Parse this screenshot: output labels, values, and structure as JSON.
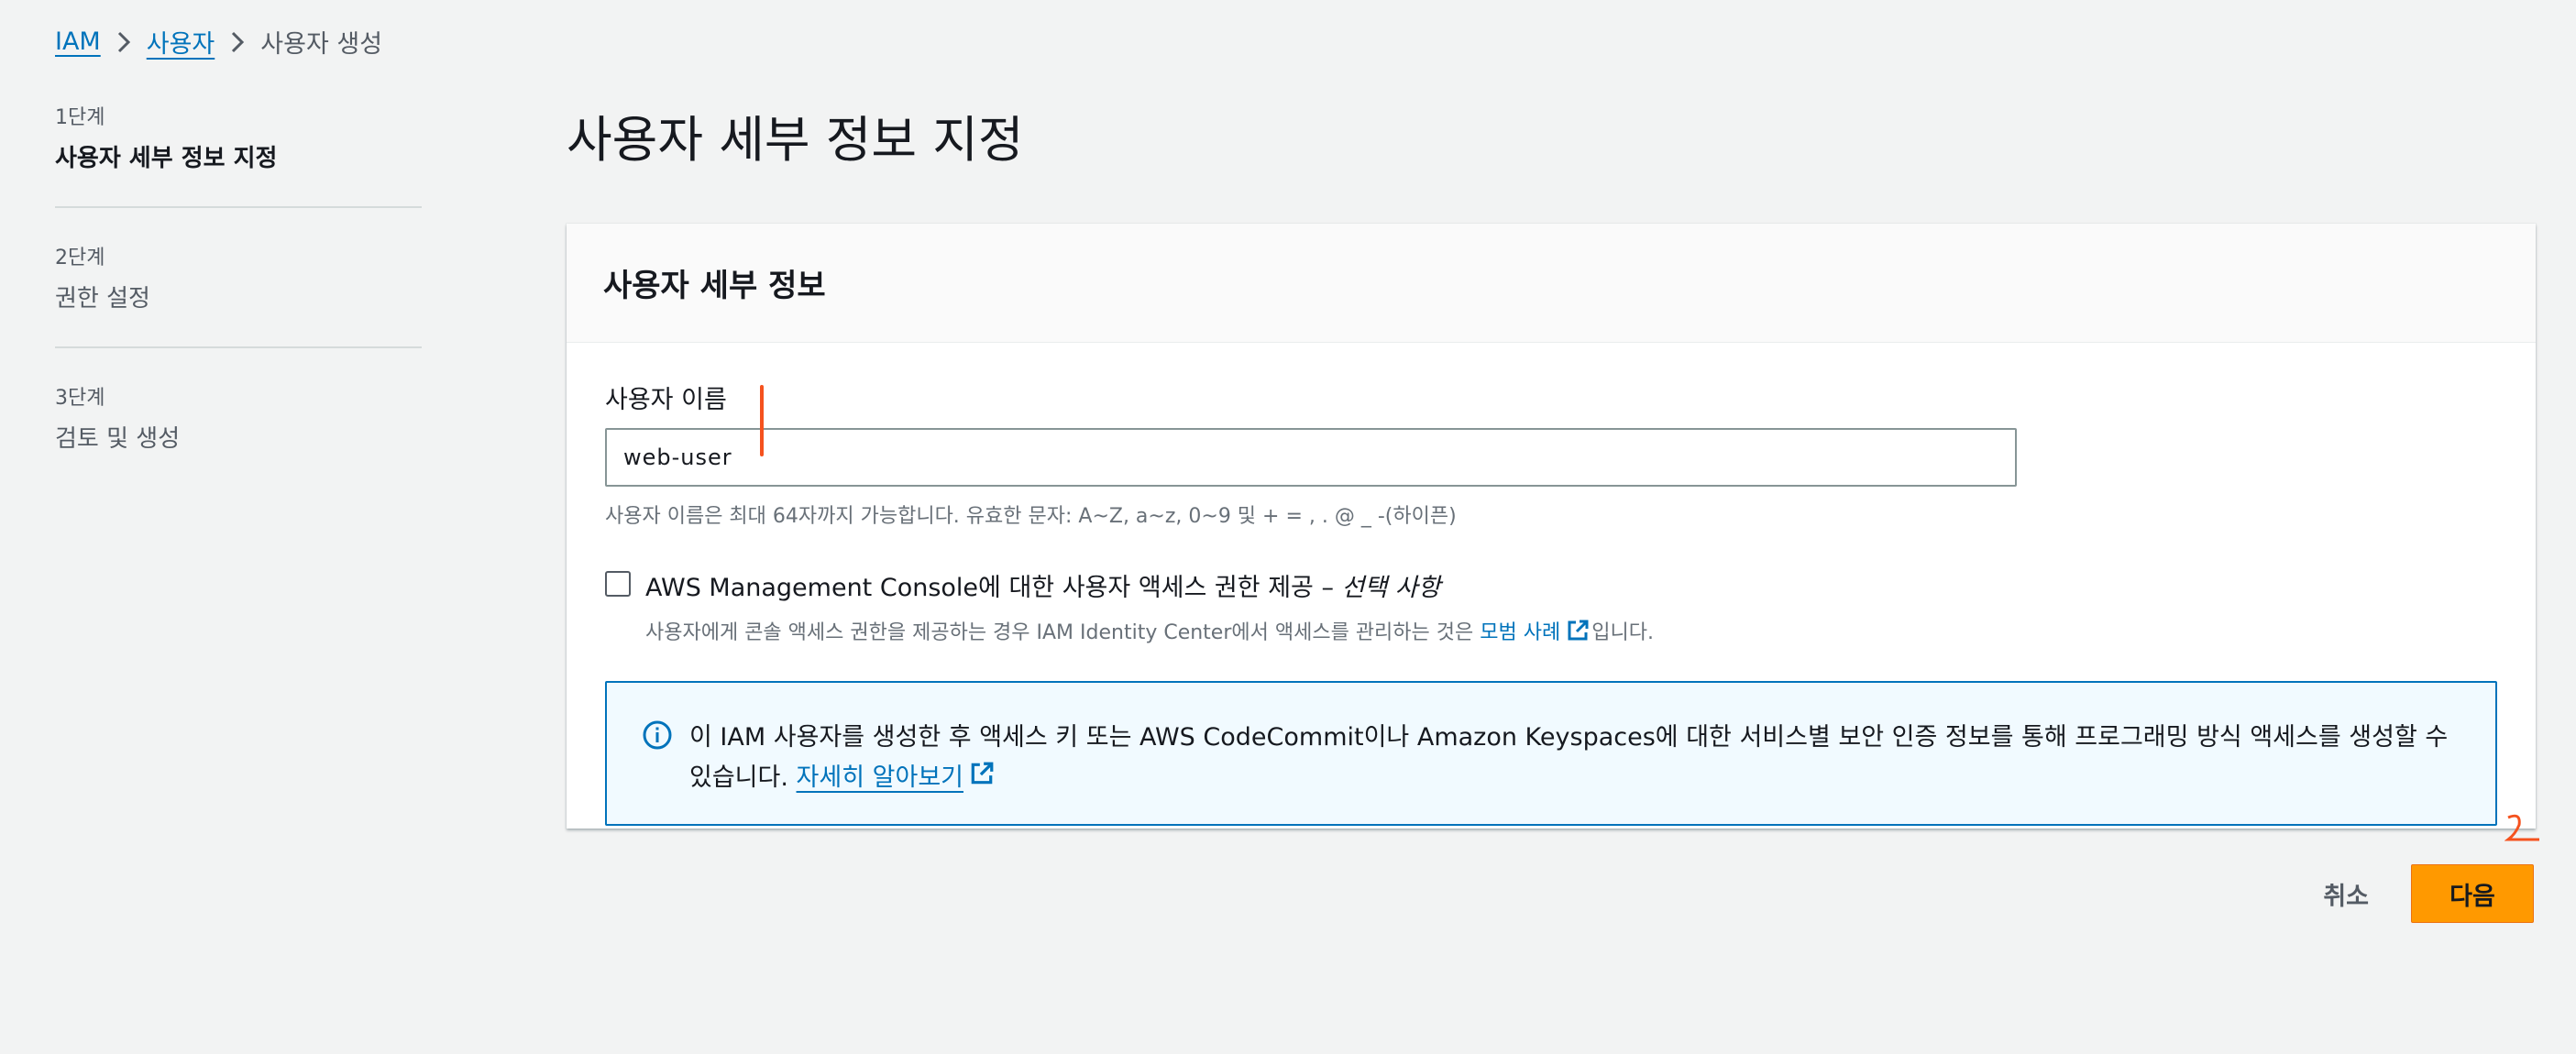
{
  "breadcrumb": {
    "items": [
      "IAM",
      "사용자"
    ],
    "current": "사용자 생성"
  },
  "steps": [
    {
      "num": "1단계",
      "label": "사용자 세부 정보 지정"
    },
    {
      "num": "2단계",
      "label": "권한 설정"
    },
    {
      "num": "3단계",
      "label": "검토 및 생성"
    }
  ],
  "page_title": "사용자 세부 정보 지정",
  "card": {
    "title": "사용자 세부 정보",
    "username_label": "사용자 이름",
    "username_value": "web-user",
    "username_hint": "사용자 이름은 최대 64자까지 가능합니다. 유효한 문자: A~Z, a~z, 0~9 및 + = , . @ _ -(하이픈)",
    "console_access_label": "AWS Management Console에 대한 사용자 액세스 권한 제공 –",
    "console_access_optional": "선택 사항",
    "console_access_desc_pre": "사용자에게 콘솔 액세스 권한을 제공하는 경우 IAM Identity Center에서 액세스를 관리하는 것은",
    "console_access_desc_link": "모범 사례",
    "console_access_desc_post": "입니다.",
    "info_text": "이 IAM 사용자를 생성한 후 액세스 키 또는 AWS CodeCommit이나 Amazon Keyspaces에 대한 서비스별 보안 인증 정보를 통해 프로그래밍 방식 액세스를 생성할 수 있습니다.",
    "info_link": "자세히 알아보기"
  },
  "actions": {
    "cancel": "취소",
    "next": "다음"
  },
  "colors": {
    "link": "#0073bb",
    "primary_button": "#ff9900",
    "annotation": "#f5521e"
  }
}
